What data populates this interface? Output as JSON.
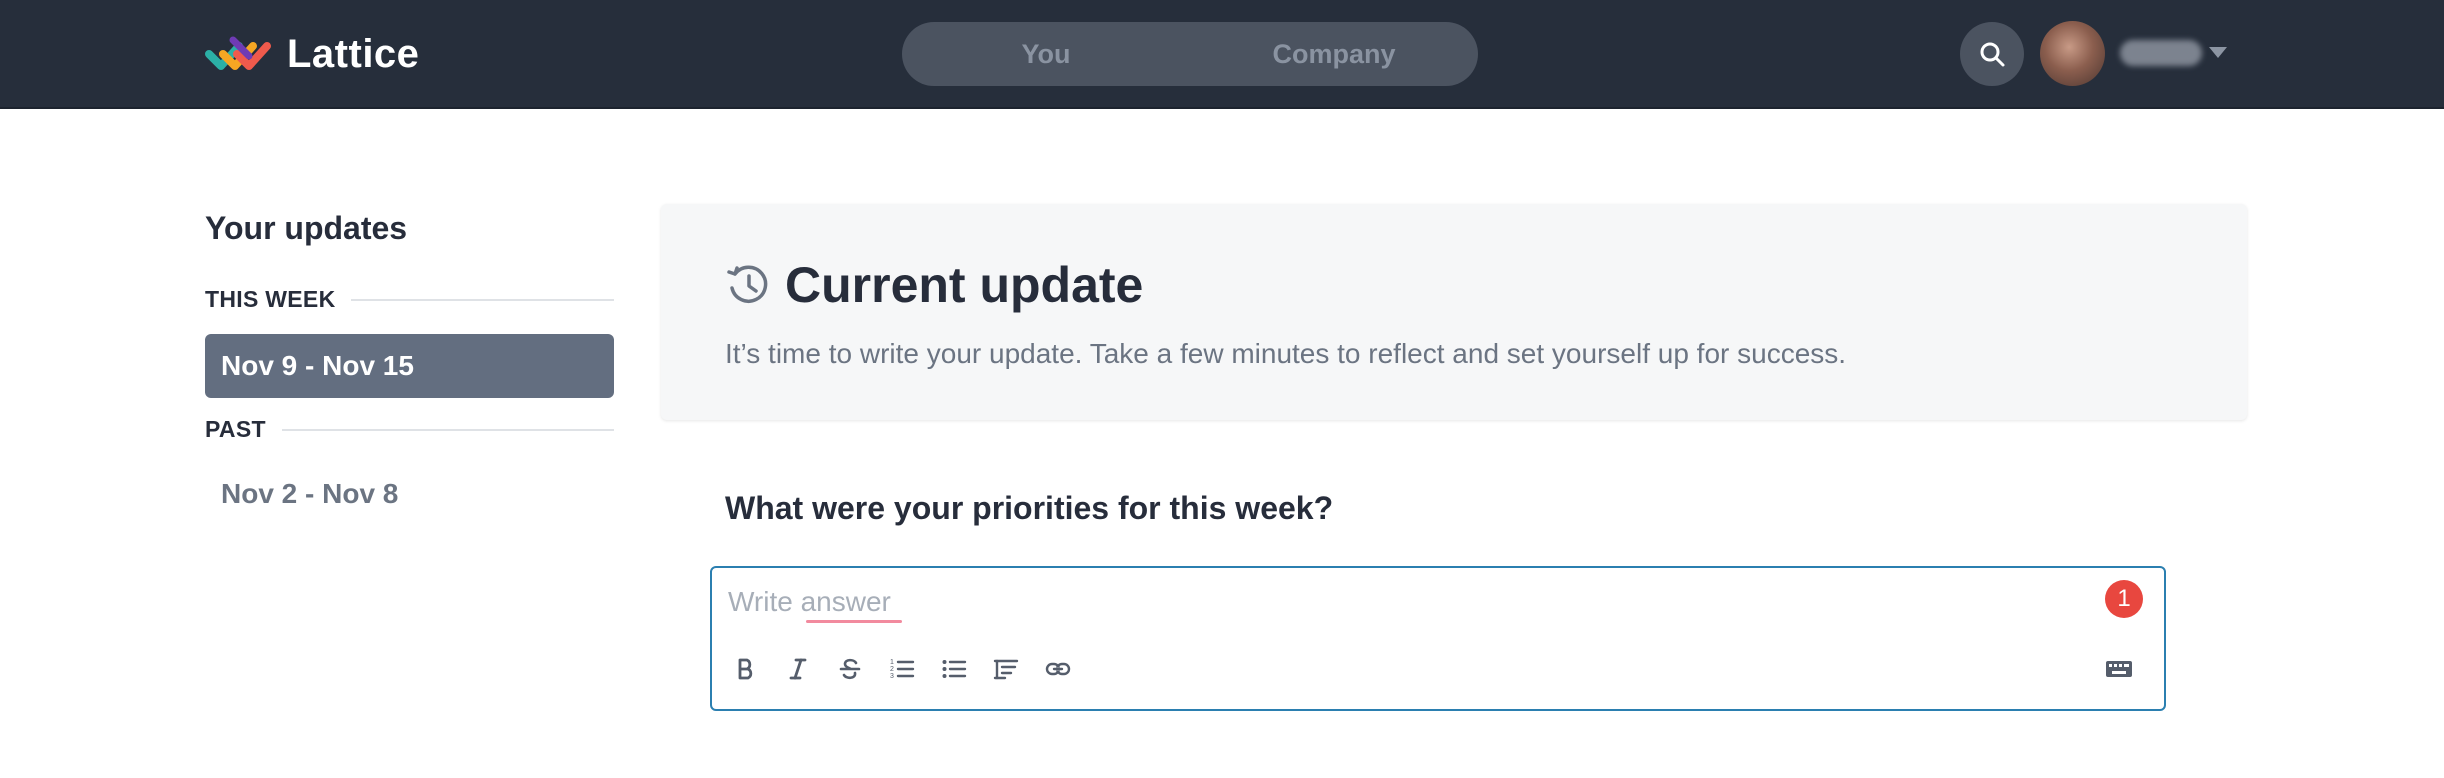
{
  "nav": {
    "brand": "Lattice",
    "tabs": [
      {
        "label": "You"
      },
      {
        "label": "Company"
      }
    ]
  },
  "sidebar": {
    "title": "Your updates",
    "sections": [
      {
        "label": "THIS WEEK",
        "items": [
          {
            "label": "Nov 9 - Nov 15",
            "active": true
          }
        ]
      },
      {
        "label": "PAST",
        "items": [
          {
            "label": "Nov 2 - Nov 8",
            "active": false
          }
        ]
      }
    ]
  },
  "card": {
    "title": "Current update",
    "subtitle": "It’s time to write your update. Take a few minutes to reflect and set yourself up for success."
  },
  "question": {
    "label": "What were your priorities for this week?",
    "placeholder": "Write answer",
    "value": "",
    "notification_count": "1"
  },
  "editor_toolbar": [
    "bold-icon",
    "italic-icon",
    "strikethrough-icon",
    "numbered-list-icon",
    "bulleted-list-icon",
    "indent-icon",
    "link-icon"
  ],
  "colors": {
    "topbar": "#262e3b",
    "active_item": "#636e80",
    "focus_border": "#2b7fb0",
    "badge": "#e8473f"
  }
}
